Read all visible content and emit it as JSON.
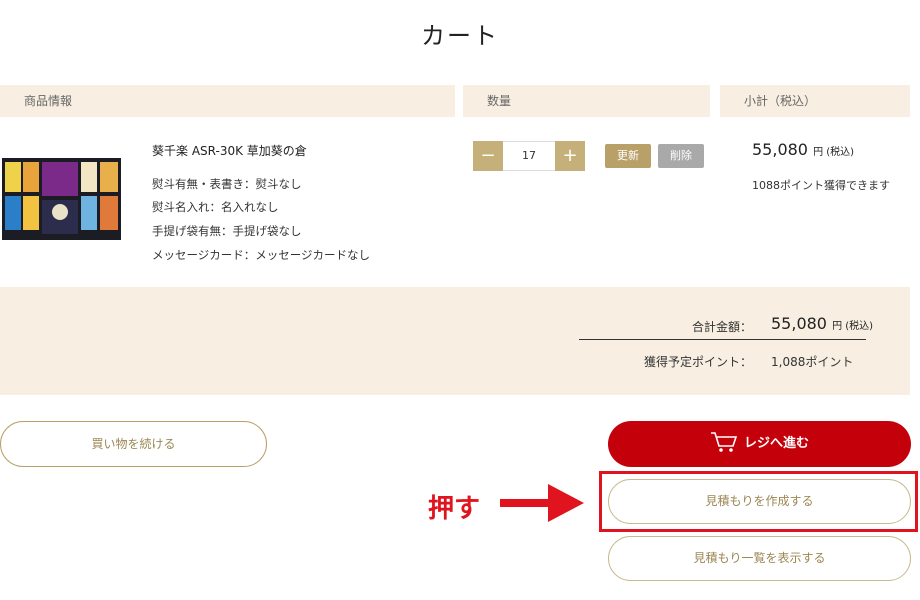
{
  "page": {
    "title": "カート"
  },
  "table": {
    "headers": {
      "product": "商品情報",
      "quantity": "数量",
      "subtotal": "小計（税込）"
    }
  },
  "item": {
    "name": "葵千楽 ASR-30K 草加葵の倉",
    "options": [
      "熨斗有無・表書き：熨斗なし",
      "熨斗名入れ：名入れなし",
      "手提げ袋有無：手提げ袋なし",
      "メッセージカード：メッセージカードなし"
    ],
    "quantity": "17",
    "minus_label": "−",
    "plus_label": "+",
    "update_label": "更新",
    "delete_label": "削除",
    "subtotal_price": "55,080",
    "subtotal_unit": "円 (税込)",
    "points_message": "1088ポイント獲得できます"
  },
  "summary": {
    "total_label": "合計金額：",
    "total_price": "55,080",
    "total_unit": "円 (税込)",
    "points_label": "獲得予定ポイント：",
    "points_value": "1,088ポイント"
  },
  "buttons": {
    "continue_shopping": "買い物を続ける",
    "checkout": "レジへ進む",
    "create_quote": "見積もりを作成する",
    "quote_list": "見積もり一覧を表示する"
  },
  "annotation": {
    "text": "押す"
  },
  "colors": {
    "accent_gold": "#b9a068",
    "checkout_red": "#c4000b",
    "header_beige": "#f8efe2",
    "annotation_red": "#e0141e"
  }
}
